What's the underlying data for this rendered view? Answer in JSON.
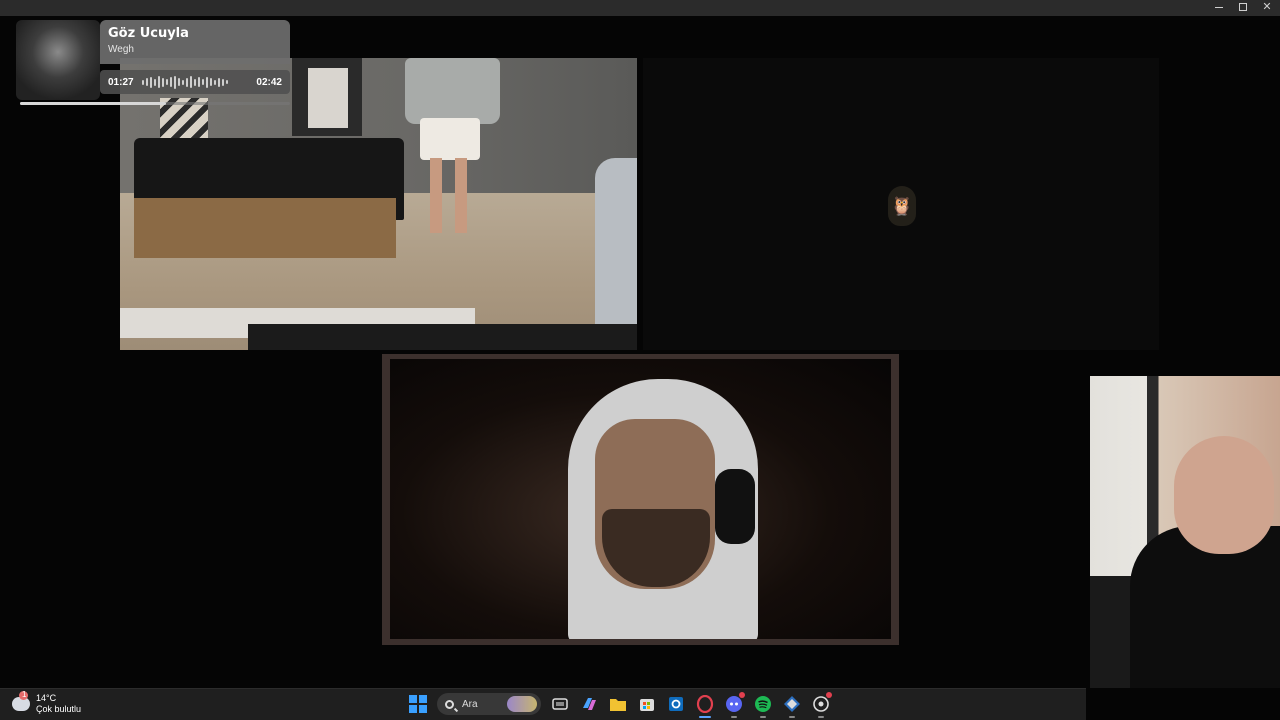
{
  "music_widget": {
    "title": "Göz Ucuyla",
    "artist": "Wegh",
    "elapsed": "01:27",
    "duration": "02:42",
    "progress_fraction": 0.54,
    "icons": {
      "album_art": "album-art-image",
      "waveform": "waveform-icon"
    }
  },
  "taskbar": {
    "weather": {
      "temperature": "14°C",
      "condition": "Çok bulutlu",
      "badge": "1"
    },
    "search_placeholder": "Ara",
    "pinned": [
      {
        "name": "start-button",
        "icon": "windows-icon"
      },
      {
        "name": "task-view",
        "icon": "task-view-icon"
      },
      {
        "name": "copilot",
        "icon": "copilot-icon"
      },
      {
        "name": "file-explorer",
        "icon": "folder-icon"
      },
      {
        "name": "microsoft-store",
        "icon": "store-icon"
      },
      {
        "name": "outlook",
        "icon": "outlook-icon"
      },
      {
        "name": "opera-gx",
        "icon": "opera-icon"
      },
      {
        "name": "discord",
        "icon": "discord-icon"
      },
      {
        "name": "spotify",
        "icon": "spotify-icon"
      },
      {
        "name": "kite-app",
        "icon": "kite-icon"
      },
      {
        "name": "chatgpt",
        "icon": "chatgpt-icon"
      }
    ]
  },
  "colors": {
    "accent": "#5aa3ff",
    "spotify": "#1db954",
    "opera": "#e2404f",
    "discord": "#5865f2"
  }
}
